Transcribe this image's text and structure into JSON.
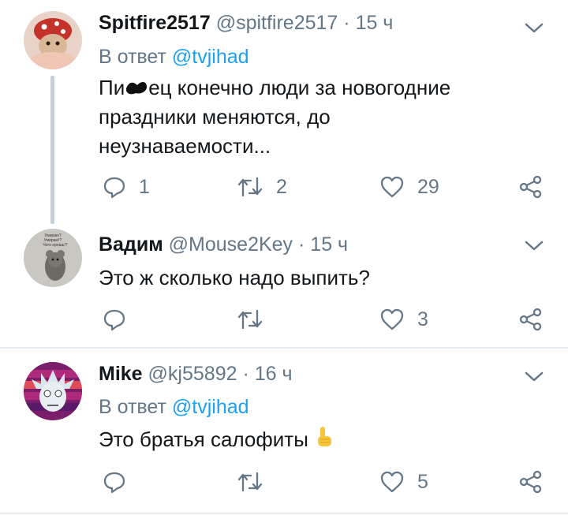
{
  "tweets": [
    {
      "name": "Spitfire2517",
      "handle": "@spitfire2517",
      "separator": "·",
      "time": "15 ч",
      "reply_prefix": "В ответ",
      "reply_mention": "@tvjihad",
      "text_part1": "Пи",
      "text_part2": "ец конечно люди за новогодние",
      "text_line2": "праздники меняются, до",
      "text_line3": "неузнаваемости...",
      "reply_count": "1",
      "retweet_count": "2",
      "like_count": "29"
    },
    {
      "name": "Вадим",
      "handle": "@Mouse2Key",
      "separator": "·",
      "time": "15 ч",
      "avatar_caption": "Умираю? Умираю!? Чего орешь!?",
      "text": "Это ж сколько надо выпить?",
      "reply_count": "",
      "retweet_count": "",
      "like_count": "3"
    },
    {
      "name": "Mike",
      "handle": "@kj55892",
      "separator": "·",
      "time": "16 ч",
      "reply_prefix": "В ответ",
      "reply_mention": "@tvjihad",
      "text": "Это братья салофиты",
      "reply_count": "",
      "retweet_count": "",
      "like_count": "5"
    }
  ],
  "icons": {
    "reply": "reply-icon",
    "retweet": "retweet-icon",
    "like": "heart-icon",
    "share": "share-icon",
    "menu": "chevron-down-icon"
  },
  "colors": {
    "text": "#14171a",
    "muted": "#657786",
    "link": "#1da1f2",
    "divider": "#e6ecf0",
    "thread_line": "#c4cfd6"
  }
}
